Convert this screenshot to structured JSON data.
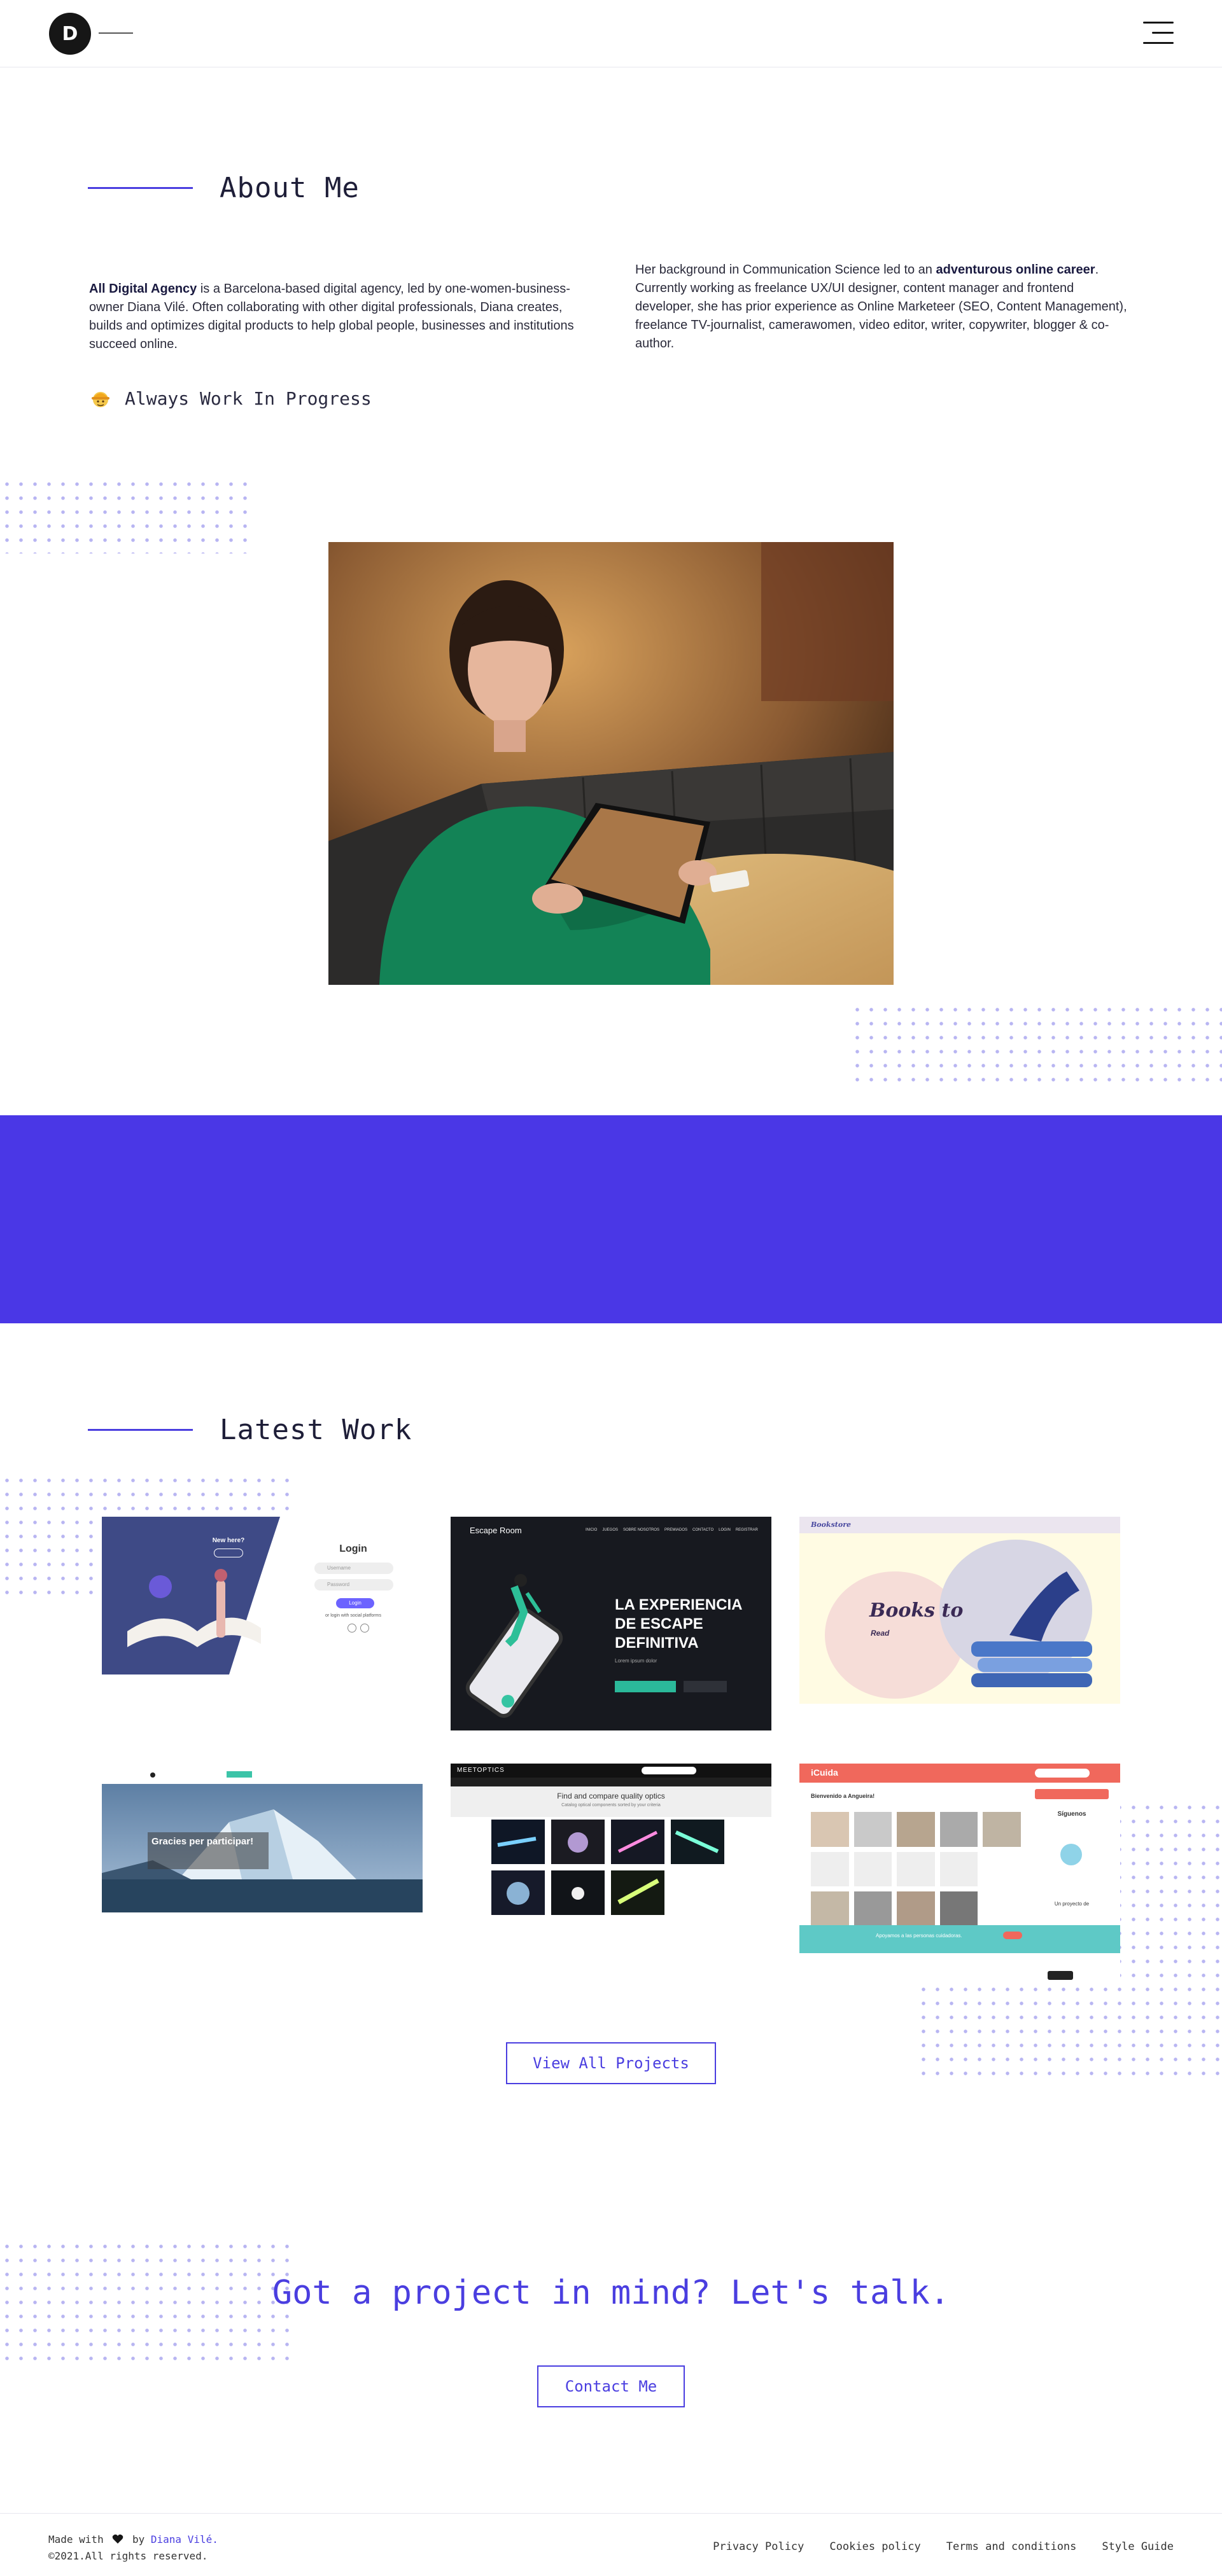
{
  "header": {
    "logo_letter": "D",
    "menu_icon": "hamburger-menu-icon"
  },
  "about": {
    "title": "About Me",
    "p1_strong": "All Digital Agency",
    "p1_rest": " is a Barcelona-based digital agency, led by one-women-business-owner Diana Vilé. Often collaborating with other digital professionals, Diana creates, builds and optimizes digital products to help global people, businesses and institutions succeed online.",
    "p2_start": "Her background in Communication Science led to an ",
    "p2_strong": "adventurous online career",
    "p2_rest": ". Currently working as freelance UX/UI designer, content manager and frontend developer, she has prior experience as Online Marketeer (SEO, Content Management), freelance TV-journalist, camerawomen, video editor, writer, copywriter, blogger & co-author.",
    "motto": "Always Work In Progress"
  },
  "work": {
    "title": "Latest Work",
    "cards": [
      {
        "heading": "Login",
        "subheading": "New here?",
        "field1": "Username",
        "field2": "Password",
        "button": "Login",
        "social": "or login with social platforms"
      },
      {
        "brand": "Escape Room",
        "nav": [
          "INICIO",
          "JUEGOS",
          "SOBRE NOSOTROS",
          "PREMIADOS",
          "CONTACTO",
          "LOGIN",
          "REGISTRAR"
        ],
        "headline_1": "LA EXPERIENCIA",
        "headline_2": "DE ESCAPE",
        "headline_3": "DEFINITIVA",
        "sub": "Lorem ipsum dolor"
      },
      {
        "brand": "Bookstore",
        "hero": "Books to",
        "hero2": "Read"
      },
      {
        "hero": "Gracies per participar!"
      },
      {
        "brand": "MEETOPTICS",
        "hero": "Find and compare quality optics",
        "sub": "Catalog optical components sorted by your criteria"
      },
      {
        "brand": "iCuida",
        "hero": "Bienvenido a Angueira!",
        "follow": "Síguenos",
        "login": "Un proyecto de",
        "banner": "Apoyamos a las personas cuidadoras."
      }
    ],
    "view_all": "View All Projects"
  },
  "cta": {
    "title": "Got a project in mind? Let's talk.",
    "button": "Contact Me"
  },
  "footer": {
    "made_with": "Made with",
    "by": "by",
    "author": "Diana Vilé.",
    "copyright": "©2021.All rights reserved.",
    "links": [
      "Privacy Policy",
      "Cookies policy",
      "Terms and conditions",
      "Style Guide"
    ]
  },
  "colors": {
    "accent": "#4a3ee0",
    "band": "#4a37e6",
    "dark": "#161616"
  }
}
